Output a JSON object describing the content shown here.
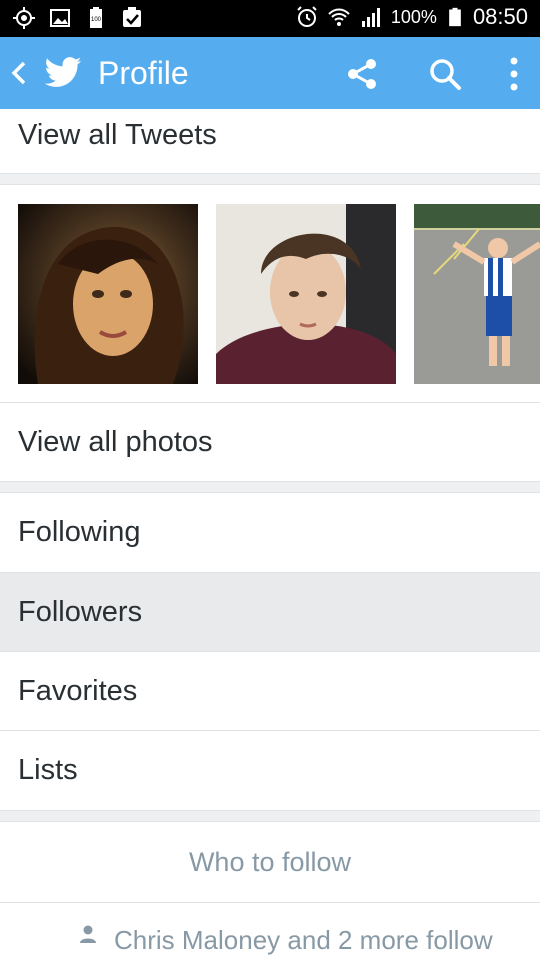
{
  "status_bar": {
    "battery_level": "100%",
    "time": "08:50",
    "icons": [
      "gps-icon",
      "gallery-icon",
      "battery-saver-icon",
      "checkbox-icon",
      "alarm-icon",
      "wifi-icon",
      "signal-icon",
      "battery-icon"
    ],
    "battery_saver_label": "100"
  },
  "appbar": {
    "title": "Profile",
    "color": "#55acee",
    "icons": [
      "back-icon",
      "twitter-bird-icon",
      "share-icon",
      "search-icon",
      "more-vert-icon"
    ]
  },
  "sections": {
    "view_all_tweets": "View all Tweets",
    "view_all_photos": "View all photos",
    "menu": [
      {
        "label": "Following",
        "selected": false
      },
      {
        "label": "Followers",
        "selected": true
      },
      {
        "label": "Favorites",
        "selected": false
      },
      {
        "label": "Lists",
        "selected": false
      }
    ],
    "who_to_follow": "Who to follow",
    "social_context": "Chris Maloney and 2 more follow"
  },
  "colors": {
    "row_text": "#292f33",
    "selected_row": "#e8eaeb",
    "muted_text": "#8899a6"
  }
}
